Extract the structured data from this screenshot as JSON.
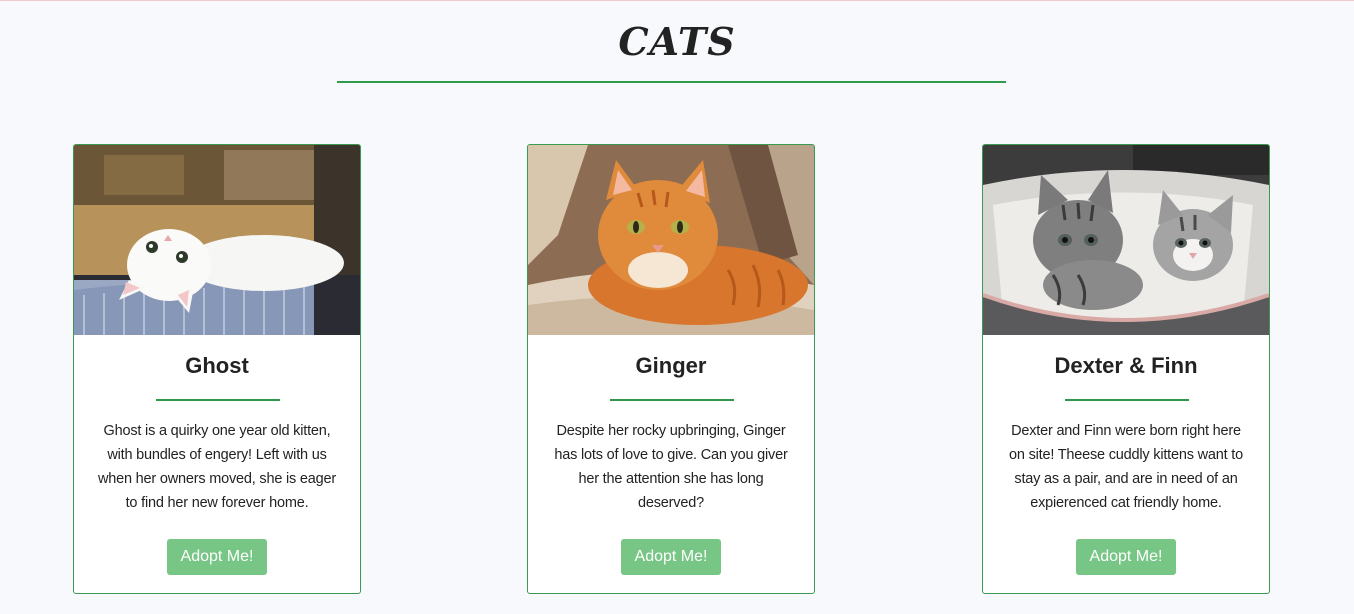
{
  "section": {
    "title": "CATS"
  },
  "cards": [
    {
      "name": "Ghost",
      "description": "Ghost is a quirky one year old kitten, with bundles of engery! Left with us when her owners moved, she is eager to find her new forever home.",
      "button_label": "Adopt Me!"
    },
    {
      "name": "Ginger",
      "description": "Despite her rocky upbringing, Ginger has lots of love to give. Can you giver her the attention she has long deserved?",
      "button_label": "Adopt Me!"
    },
    {
      "name": "Dexter & Finn",
      "description": "Dexter and Finn were born right here on site! Theese cuddly kittens want to stay as a pair, and are in need of an expierenced cat friendly home.",
      "button_label": "Adopt Me!"
    }
  ],
  "colors": {
    "accent_green": "#2f9a4c",
    "button_green": "#77c685",
    "page_background": "#f8f9fd"
  }
}
